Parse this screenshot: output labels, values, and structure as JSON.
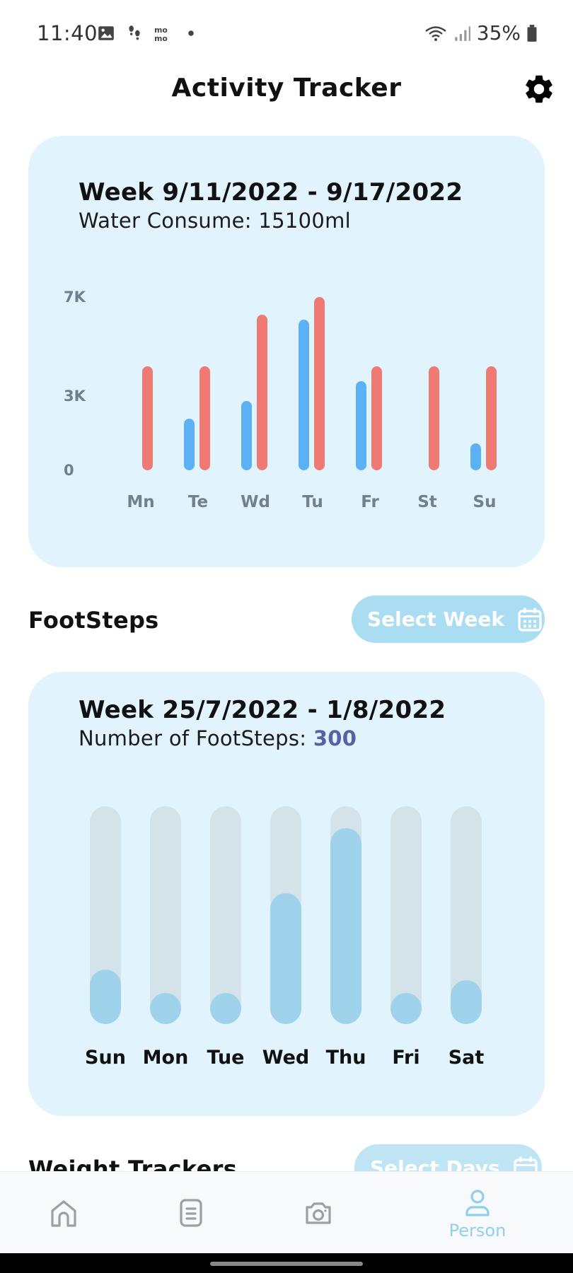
{
  "status_bar": {
    "time": "11:40",
    "battery": "35%",
    "left_icons": [
      "image-icon",
      "steps-icon",
      "momo-icon",
      "dot-icon"
    ],
    "right_icons": [
      "wifi-icon",
      "signal-icon",
      "battery-icon"
    ]
  },
  "header": {
    "title": "Activity Tracker",
    "settings_icon": "gear-icon"
  },
  "water_card": {
    "title": "Week 9/11/2022 - 9/17/2022",
    "subtitle": "Water Consume: 15100ml",
    "colors": {
      "series_a": "#5bb1f4",
      "series_b": "#ef7a74"
    }
  },
  "chart_data": {
    "type": "bar",
    "categories": [
      "Mn",
      "Te",
      "Wd",
      "Tu",
      "Fr",
      "St",
      "Su"
    ],
    "y_tick_labels": [
      "0",
      "3K",
      "7K"
    ],
    "ylim": [
      0,
      7000
    ],
    "series": [
      {
        "values": [
          0,
          2100,
          2800,
          6100,
          3600,
          0,
          1100
        ]
      },
      {
        "values": [
          4200,
          4200,
          6300,
          7000,
          4200,
          4200,
          4200
        ]
      }
    ],
    "grid": false,
    "title": "",
    "xlabel": "",
    "ylabel": ""
  },
  "footsteps_section": {
    "title": "FootSteps",
    "select_button": "Select Week",
    "select_icon": "calendar-icon"
  },
  "steps_card": {
    "title": "Week 25/7/2022 - 1/8/2022",
    "subtitle_label": "Number of FootSteps: ",
    "subtitle_value": "300",
    "days": [
      "Sun",
      "Mon",
      "Tue",
      "Wed",
      "Thu",
      "Fri",
      "Sat"
    ],
    "fill_fraction": [
      0.25,
      0.14,
      0.14,
      0.6,
      0.9,
      0.14,
      0.2
    ]
  },
  "weight_section": {
    "title": "Weight Trackers",
    "select_button": "Select Days",
    "select_icon": "calendar-icon"
  },
  "bottom_nav": {
    "items": [
      {
        "icon": "home-icon",
        "label": ""
      },
      {
        "icon": "document-icon",
        "label": ""
      },
      {
        "icon": "camera-icon",
        "label": ""
      },
      {
        "icon": "person-icon",
        "label": "Person"
      }
    ],
    "active_color": "#8fd0ee"
  }
}
